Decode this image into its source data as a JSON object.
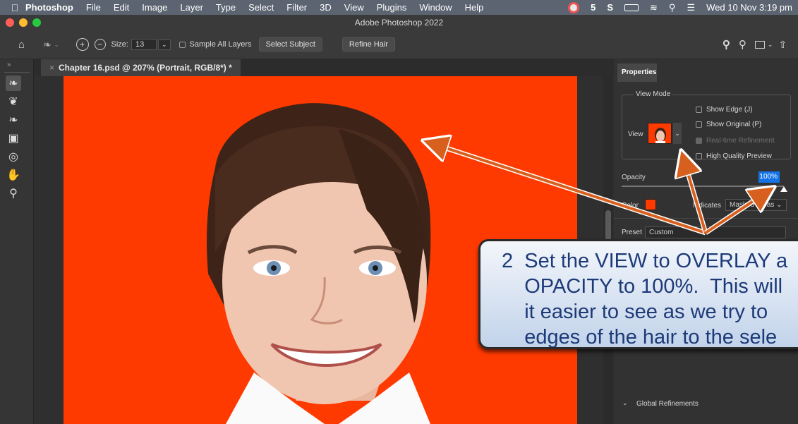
{
  "menubar": {
    "app": "Photoshop",
    "items": [
      "File",
      "Edit",
      "Image",
      "Layer",
      "Type",
      "Select",
      "Filter",
      "3D",
      "View",
      "Plugins",
      "Window",
      "Help"
    ],
    "clock": "Wed 10 Nov  3:19 pm"
  },
  "window": {
    "title": "Adobe Photoshop 2022"
  },
  "options": {
    "size_label": "Size:",
    "size_value": "13",
    "sample_all_layers": "Sample All Layers",
    "select_subject": "Select Subject",
    "refine_hair": "Refine Hair"
  },
  "document": {
    "tab_title": "Chapter 16.psd @ 207% (Portrait, RGB/8*) *"
  },
  "properties": {
    "tab_label": "Properties",
    "view_mode_label": "View Mode",
    "view_label": "View",
    "show_edge": "Show Edge (J)",
    "show_original": "Show Original (P)",
    "realtime_refinement": "Real-time Refinement",
    "high_quality_preview": "High Quality Preview",
    "opacity_label": "Opacity",
    "opacity_value": "100%",
    "opacity_fraction": 1.0,
    "color_label": "Color",
    "indicates_label": "Indicates",
    "indicates_value": "Masked Areas",
    "preset_label": "Preset",
    "preset_value": "Custom",
    "global_refinements": "Global Refinements"
  },
  "colors": {
    "overlay": "#ff3a00",
    "accent": "#1473e6",
    "callout_text": "#1d3a78"
  },
  "callout": {
    "step": "2",
    "lines": [
      "Set the VIEW to OVERLAY a",
      "OPACITY to 100%.  This will",
      "it easier to see as we try to",
      "edges of the hair to the sele"
    ]
  }
}
